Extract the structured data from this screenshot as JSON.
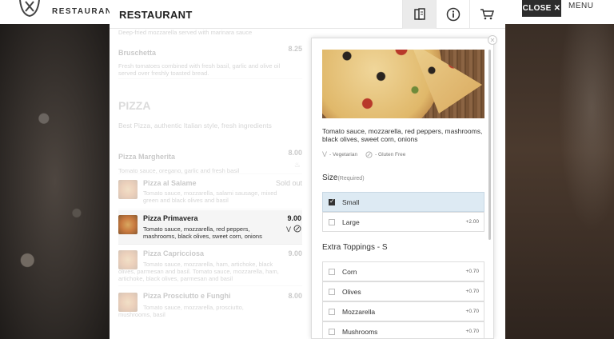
{
  "top_bar": {
    "brand": "RESTAURANT",
    "close_label": "CLOSE",
    "menu_label": "MENU"
  },
  "panel": {
    "title": "RESTAURANT",
    "header_icons": [
      "menu-book-icon",
      "info-icon",
      "cart-icon"
    ]
  },
  "menu": {
    "partial_desc": "Deep-fried mozzarella served with marinara sauce",
    "bruschetta": {
      "name": "Bruschetta",
      "price": "8.25",
      "desc": "Fresh tomatoes combined with fresh basil, garlic and olive oil served over freshly toasted bread."
    },
    "section": {
      "title": "PIZZA",
      "subtitle": "Best Pizza, authentic Italian style, fresh ingredients"
    },
    "items": [
      {
        "name": "Pizza Margherita",
        "price": "8.00",
        "desc": "Tomato sauce, oregano, garlic and fresh basil",
        "badge": "fire-icon"
      },
      {
        "name": "Pizza al Salame",
        "price": "Sold out",
        "desc": "Tomato sauce, mozzarella, salami sausage, mixed green and black olives and basil"
      },
      {
        "name": "Pizza Primavera",
        "price": "9.00",
        "desc": "Tomato sauce, mozzarella, red peppers, mashrooms, black olives, sweet corn, onions"
      },
      {
        "name": "Pizza Capricciosa",
        "price": "9.00",
        "desc": "Tomato sauce, mozzarella, ham, artichoke, black olives, parmesan and basil. Tomato sauce, mozzarella, ham, artichoke, black olives, parmesan and basil"
      },
      {
        "name": "Pizza Prosciutto e Funghi",
        "price": "8.00",
        "desc": "Tomato sauce, mozzarella, prosciutto, mushrooms, basil"
      }
    ]
  },
  "modal": {
    "description": "Tomato sauce, mozzarella, red peppers, mashrooms, black olives, sweet corn, onions",
    "tags": [
      {
        "icon": "vegetarian-icon",
        "label": "- Vegetarian"
      },
      {
        "icon": "gluten-free-icon",
        "label": "- Gluten Free"
      }
    ],
    "size_title": "Size",
    "size_required": "(Required)",
    "sizes": [
      {
        "label": "Small",
        "price": "",
        "checked": true
      },
      {
        "label": "Large",
        "price": "+2.00",
        "checked": false
      }
    ],
    "extra_title": "Extra Toppings - S",
    "extras": [
      {
        "label": "Corn",
        "price": "+0.70"
      },
      {
        "label": "Olives",
        "price": "+0.70"
      },
      {
        "label": "Mozzarella",
        "price": "+0.70"
      },
      {
        "label": "Mushrooms",
        "price": "+0.70"
      }
    ]
  }
}
